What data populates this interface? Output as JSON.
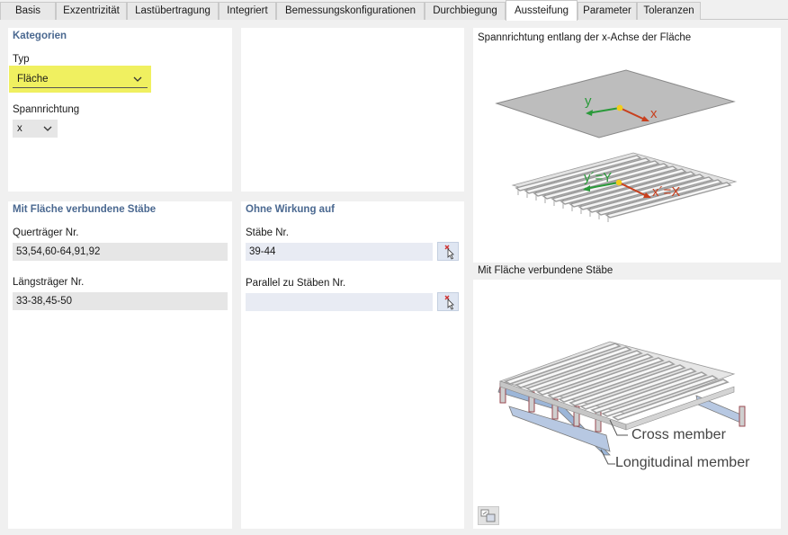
{
  "tabs": [
    {
      "label": "Basis",
      "active": false
    },
    {
      "label": "Exzentrizität",
      "active": false
    },
    {
      "label": "Lastübertragung",
      "active": false
    },
    {
      "label": "Integriert",
      "active": false
    },
    {
      "label": "Bemessungskonfigurationen",
      "active": false
    },
    {
      "label": "Durchbiegung",
      "active": false
    },
    {
      "label": "Aussteifung",
      "active": true
    },
    {
      "label": "Parameter",
      "active": false
    },
    {
      "label": "Toleranzen",
      "active": false
    }
  ],
  "kategorien": {
    "title": "Kategorien",
    "typ_label": "Typ",
    "typ_value": "Fläche",
    "spann_label": "Spannrichtung",
    "spann_value": "x"
  },
  "verbundene": {
    "title": "Mit Fläche verbundene Stäbe",
    "quer_label": "Querträger Nr.",
    "quer_value": "53,54,60-64,91,92",
    "laengs_label": "Längsträger Nr.",
    "laengs_value": "33-38,45-50"
  },
  "ohne": {
    "title": "Ohne Wirkung auf",
    "staebe_label": "Stäbe Nr.",
    "staebe_value": "39-44",
    "parallel_label": "Parallel zu Stäben Nr.",
    "parallel_value": ""
  },
  "preview": {
    "top_caption": "Spannrichtung entlang der x-Achse der Fläche",
    "axis_y": "y",
    "axis_x": "x",
    "axis_y2": "y´=Y",
    "axis_x2": "x´=X",
    "bottom_caption": "Mit Fläche verbundene Stäbe",
    "cross_member": "Cross member",
    "longitudinal_member": "Longitudinal member"
  },
  "colors": {
    "section_title": "#4a6890",
    "highlight": "#f0f060",
    "axis_green": "#2a9a3a",
    "axis_red": "#d04020"
  }
}
